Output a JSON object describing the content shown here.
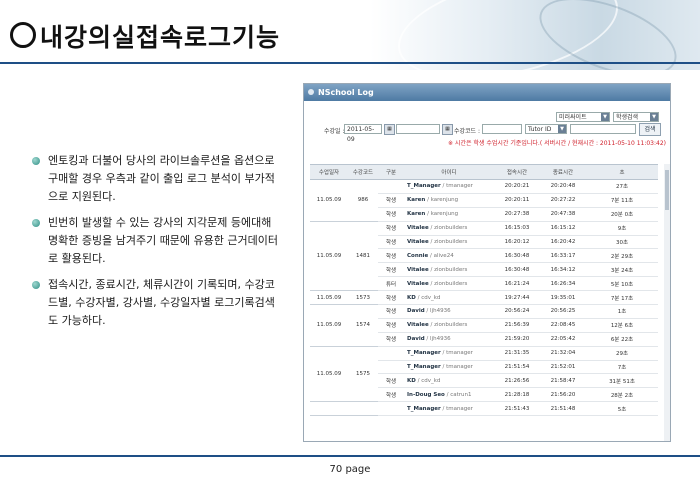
{
  "title": "내강의실접속로그기능",
  "bullets": [
    "엔토킹과 더불어 당사의 라이브솔루션을 옵션으로 구매할 경우 우측과 같이 출입 로그 분석이 부가적으로 지원된다.",
    "빈번히 발생할 수 있는 강사의 지각문제 등에대해 명확한 증빙을 남겨주기 때문에 유용한 근거데이터로 활용된다.",
    "접속시간, 종료시간, 체류시간이 기록되며, 수강코드별, 수강자별, 강사별, 수강일자별 로그기록검색도 가능하다."
  ],
  "window": {
    "title": "NSchool Log",
    "site_select": "미러싸이트",
    "search_type": "학생검색",
    "date_label": "수강일 :",
    "date_from": "2011-05-09",
    "code_label": "수강코드 :",
    "tutor_select": "Tutor ID",
    "search_button": "검색",
    "notice": "※ 시간은 학생 수업시간 기준입니다.( 서버시간 / 현재시간 : 2011-05-10 11:03:42)",
    "columns": [
      "수업일자",
      "수강코드",
      "구분",
      "아이디",
      "접속시간",
      "종료시간",
      "초"
    ],
    "groups": [
      {
        "date": "11.05.09",
        "code": "986",
        "rows": [
          {
            "type": "",
            "name": "T_Manager",
            "uid": "tmanager",
            "start": "20:20:21",
            "end": "20:20:48",
            "dur": "27초"
          },
          {
            "type": "학생",
            "name": "Karen",
            "uid": "karenjung",
            "start": "20:20:11",
            "end": "20:27:22",
            "dur": "7분 11초"
          },
          {
            "type": "학생",
            "name": "Karen",
            "uid": "karenjung",
            "start": "20:27:38",
            "end": "20:47:38",
            "dur": "20분 0초"
          }
        ]
      },
      {
        "date": "11.05.09",
        "code": "1481",
        "rows": [
          {
            "type": "학생",
            "name": "Vitalee",
            "uid": "zionbuilders",
            "start": "16:15:03",
            "end": "16:15:12",
            "dur": "9초"
          },
          {
            "type": "학생",
            "name": "Vitalee",
            "uid": "zionbuilders",
            "start": "16:20:12",
            "end": "16:20:42",
            "dur": "30초"
          },
          {
            "type": "학생",
            "name": "Connie",
            "uid": "alive24",
            "start": "16:30:48",
            "end": "16:33:17",
            "dur": "2분 29초"
          },
          {
            "type": "학생",
            "name": "Vitalee",
            "uid": "zionbuilders",
            "start": "16:30:48",
            "end": "16:34:12",
            "dur": "3분 24초"
          },
          {
            "type": "튜터",
            "name": "Vitalee",
            "uid": "zionbuilders",
            "start": "16:21:24",
            "end": "16:26:34",
            "dur": "5분 10초"
          }
        ]
      },
      {
        "date": "11.05.09",
        "code": "1573",
        "rows": [
          {
            "type": "학생",
            "name": "KD",
            "uid": "cdv_kd",
            "start": "19:27:44",
            "end": "19:35:01",
            "dur": "7분 17초"
          }
        ]
      },
      {
        "date": "11.05.09",
        "code": "1574",
        "rows": [
          {
            "type": "학생",
            "name": "David",
            "uid": "ljh4936",
            "start": "20:56:24",
            "end": "20:56:25",
            "dur": "1초"
          },
          {
            "type": "학생",
            "name": "Vitalee",
            "uid": "zionbuilders",
            "start": "21:56:39",
            "end": "22:08:45",
            "dur": "12분 6초"
          },
          {
            "type": "학생",
            "name": "David",
            "uid": "ljh4936",
            "start": "21:59:20",
            "end": "22:05:42",
            "dur": "6분 22초"
          }
        ]
      },
      {
        "date": "11.05.09",
        "code": "1575",
        "rows": [
          {
            "type": "",
            "name": "T_Manager",
            "uid": "tmanager",
            "start": "21:31:35",
            "end": "21:32:04",
            "dur": "29초"
          },
          {
            "type": "",
            "name": "T_Manager",
            "uid": "tmanager",
            "start": "21:51:54",
            "end": "21:52:01",
            "dur": "7초"
          },
          {
            "type": "학생",
            "name": "KD",
            "uid": "cdv_kd",
            "start": "21:26:56",
            "end": "21:58:47",
            "dur": "31분 51초"
          },
          {
            "type": "학생",
            "name": "In-Doug Seo",
            "uid": "catrun1",
            "start": "21:28:18",
            "end": "21:56:20",
            "dur": "28분 2초"
          }
        ]
      },
      {
        "date": "",
        "code": "",
        "rows": [
          {
            "type": "",
            "name": "T_Manager",
            "uid": "tmanager",
            "start": "21:51:43",
            "end": "21:51:48",
            "dur": "5초"
          }
        ]
      }
    ]
  },
  "page_number": "70 page",
  "colors": {
    "accent": "#1e4f86",
    "notice": "#d0202b",
    "bullet": "#2f8f86"
  }
}
